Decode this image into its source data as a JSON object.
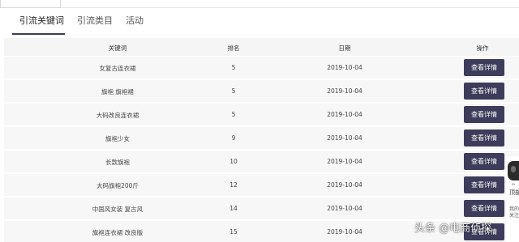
{
  "tabs": [
    {
      "label": "引流关键词",
      "active": true
    },
    {
      "label": "引流类目",
      "active": false
    },
    {
      "label": "活动",
      "active": false
    }
  ],
  "table": {
    "headers": {
      "keyword": "关键词",
      "rank": "排名",
      "date": "日期",
      "action": "操作"
    },
    "rows": [
      {
        "keyword": "女复古连衣裙",
        "rank": "5",
        "date": "2019-10-04",
        "action": "查看详情"
      },
      {
        "keyword": "旗袍 旗袍裙",
        "rank": "5",
        "date": "2019-10-04",
        "action": "查看详情"
      },
      {
        "keyword": "大码改良连衣裙",
        "rank": "5",
        "date": "2019-10-04",
        "action": "查看详情"
      },
      {
        "keyword": "旗袍少女",
        "rank": "9",
        "date": "2019-10-04",
        "action": "查看详情"
      },
      {
        "keyword": "长款旗袍",
        "rank": "10",
        "date": "2019-10-04",
        "action": "查看详情"
      },
      {
        "keyword": "大码旗袍200斤",
        "rank": "12",
        "date": "2019-10-04",
        "action": "查看详情"
      },
      {
        "keyword": "中国风女装 复古风",
        "rank": "14",
        "date": "2019-10-04",
        "action": "查看详情"
      },
      {
        "keyword": "旗袍连衣裙 改良版",
        "rank": "15",
        "date": "2019-10-04",
        "action": "查看详情"
      }
    ]
  },
  "side_widget": {
    "up_symbol": "^",
    "top_label": "顶部",
    "line1": "我的",
    "line2": "关注"
  },
  "watermark": "头条 @电商侦探",
  "colors": {
    "accent": "#3d3c5a",
    "row_bg": "#f7f7f7",
    "header_bg": "#f5f5f5"
  }
}
